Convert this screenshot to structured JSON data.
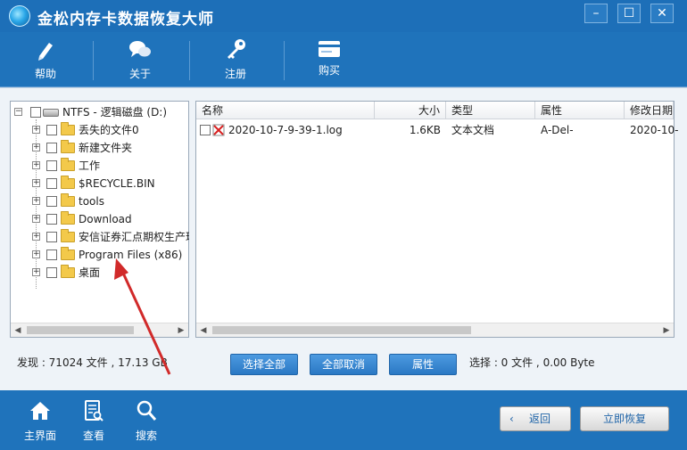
{
  "window": {
    "title": "金松内存卡数据恢复大师",
    "min": "–",
    "max": "☐",
    "close": "✕"
  },
  "toolbar": {
    "help": "帮助",
    "about": "关于",
    "register": "注册",
    "buy": "购买"
  },
  "tree": {
    "root": "NTFS - 逻辑磁盘 (D:)",
    "items": [
      "丢失的文件0",
      "新建文件夹",
      "工作",
      "$RECYCLE.BIN",
      "tools",
      "Download",
      "安信证券汇点期权生产环境",
      "Program Files (x86)",
      "桌面"
    ]
  },
  "filelist": {
    "columns": [
      "名称",
      "大小",
      "类型",
      "属性",
      "修改日期"
    ],
    "rows": [
      {
        "name": "2020-10-7-9-39-1.log",
        "size": "1.6KB",
        "type": "文本文档",
        "attr": "A-Del-",
        "date": "2020-10-"
      }
    ]
  },
  "status": {
    "found": "发现 : 71024 文件 , 17.13 GB",
    "select_all": "选择全部",
    "unselect_all": "全部取消",
    "properties": "属性",
    "selection": "选择 : 0 文件 , 0.00 Byte"
  },
  "bottom": {
    "home": "主界面",
    "view": "查看",
    "search": "搜索",
    "back": "返回",
    "recover": "立即恢复"
  },
  "colors": {
    "brand_blue": "#1f73bb",
    "button_blue": "#2a78c4",
    "annotation_red": "#d12a2a"
  }
}
